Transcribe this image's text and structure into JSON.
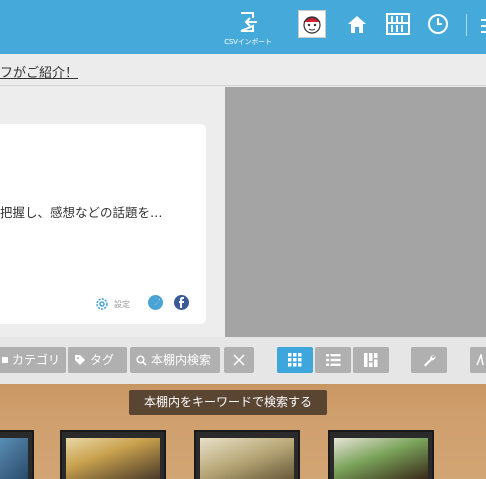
{
  "header": {
    "csv_label": "CSVインポート",
    "bg_color": "#45a9d9"
  },
  "notice": {
    "link_text": "フがご紹介！"
  },
  "card": {
    "excerpt": "把握し、感想などの話題を…",
    "setting_label": "設定"
  },
  "toolbar": {
    "category_label": "カテゴリ",
    "tag_label": "タグ",
    "search_label": "本棚内検索"
  },
  "tooltip": {
    "text": "本棚内をキーワードで検索する"
  },
  "colors": {
    "accent": "#3da7db",
    "shelf": "#cf9f6d",
    "panel_gray": "#a4a4a4"
  }
}
